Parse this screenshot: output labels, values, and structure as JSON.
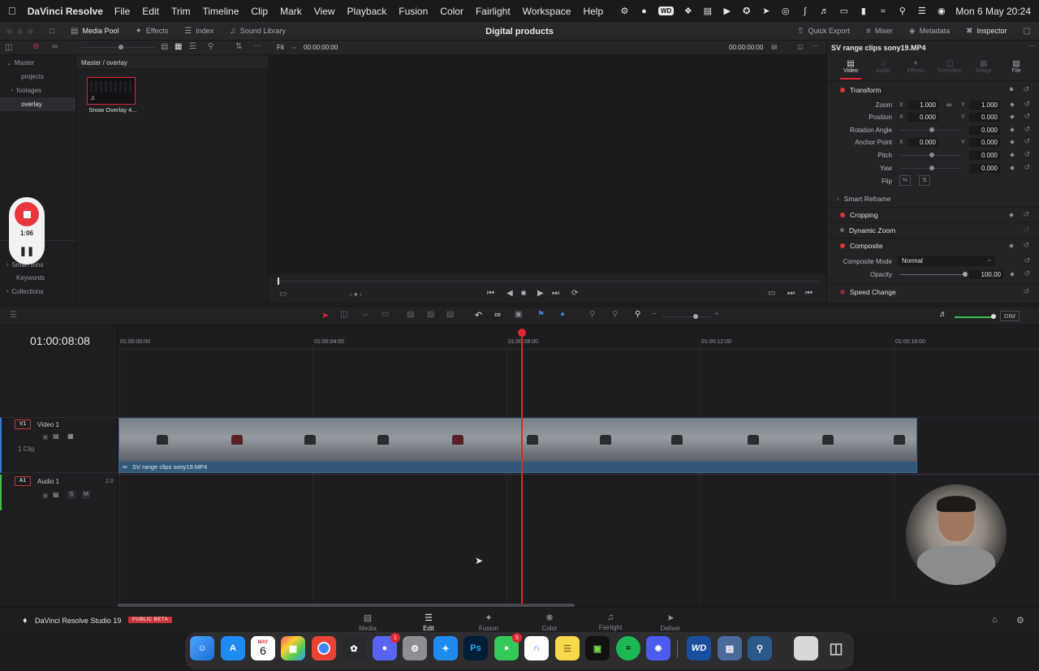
{
  "menubar": {
    "app_name": "DaVinci Resolve",
    "items": [
      "File",
      "Edit",
      "Trim",
      "Timeline",
      "Clip",
      "Mark",
      "View",
      "Playback",
      "Fusion",
      "Color",
      "Fairlight",
      "Workspace",
      "Help"
    ],
    "wd_badge": "WD",
    "datetime": "Mon 6 May  20:24"
  },
  "topbar": {
    "media_pool": "Media Pool",
    "effects": "Effects",
    "index": "Index",
    "sound_library": "Sound Library",
    "project_title": "Digital products",
    "quick_export": "Quick Export",
    "mixer": "Mixer",
    "metadata": "Metadata",
    "inspector": "Inspector"
  },
  "media_pool": {
    "bins": [
      "Master",
      "projects",
      "footages",
      "overlay"
    ],
    "selected_bin": "overlay",
    "smart_bins": "Smart Bins",
    "keywords": "Keywords",
    "collections": "Collections",
    "breadcrumb": "Master / overlay",
    "clip_name": "Snow Overlay 4..."
  },
  "viewer": {
    "fit": "Fit",
    "timecode_left": "00:00:00:00",
    "timecode_right": "00:00:00:00"
  },
  "inspector": {
    "clip_title": "SV range clips sony19.MP4",
    "tabs": [
      "Video",
      "Audio",
      "Effects",
      "Transition",
      "Image",
      "File"
    ],
    "active_tab": "Video",
    "transform": "Transform",
    "zoom_label": "Zoom",
    "zoom_x": "1.000",
    "zoom_y": "1.000",
    "position_label": "Position",
    "position_x": "0.000",
    "position_y": "0.000",
    "rotation_label": "Rotation Angle",
    "rotation": "0.000",
    "anchor_label": "Anchor Point",
    "anchor_x": "0.000",
    "anchor_y": "0.000",
    "pitch_label": "Pitch",
    "pitch": "0.000",
    "yaw_label": "Yaw",
    "yaw": "0.000",
    "flip_label": "Flip",
    "x": "X",
    "y": "Y",
    "smart_reframe": "Smart Reframe",
    "cropping": "Cropping",
    "dynamic_zoom": "Dynamic Zoom",
    "composite": "Composite",
    "composite_mode_label": "Composite Mode",
    "composite_mode": "Normal",
    "opacity_label": "Opacity",
    "opacity": "100.00",
    "speed_change": "Speed Change"
  },
  "timeline": {
    "timecode": "01:00:08:08",
    "ruler": [
      "01:00:00:00",
      "01:00:04:00",
      "01:00:08:00",
      "01:00:12:00",
      "01:00:16:00"
    ],
    "dim": "DIM",
    "video_track_badge": "V1",
    "video_track_name": "Video 1",
    "video_clip_count": "1 Clip",
    "audio_track_badge": "A1",
    "audio_track_name": "Audio 1",
    "audio_channels": "2.0",
    "solo": "S",
    "mute": "M",
    "clip_name": "SV range clips sony19.MP4"
  },
  "recorder": {
    "elapsed": "1:06"
  },
  "pagebar": {
    "product": "DaVinci Resolve Studio 19",
    "beta": "PUBLIC BETA",
    "pages": [
      "Media",
      "Edit",
      "Fusion",
      "Color",
      "Fairlight",
      "Deliver"
    ],
    "active_page": "Edit"
  },
  "dock": {
    "calendar_month": "MAY",
    "calendar_day": "6",
    "discord_badge": "1",
    "messages_badge": "5",
    "photoshop": "Ps",
    "wd": "WD"
  },
  "colors": {
    "accent_red": "#e0262e",
    "clip_blue": "#2a4660"
  }
}
